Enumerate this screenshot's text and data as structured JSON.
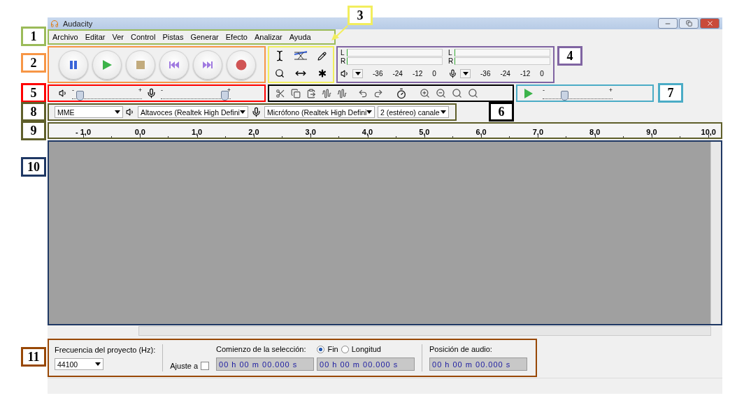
{
  "window": {
    "title": "Audacity"
  },
  "menu": [
    "Archivo",
    "Editar",
    "Ver",
    "Control",
    "Pistas",
    "Generar",
    "Efecto",
    "Analizar",
    "Ayuda"
  ],
  "meters": [
    {
      "channels": [
        "L",
        "R"
      ],
      "ticks": [
        "-36",
        "-24",
        "-12",
        "0"
      ]
    },
    {
      "channels": [
        "L",
        "R"
      ],
      "ticks": [
        "-36",
        "-24",
        "-12",
        "0"
      ]
    }
  ],
  "mixer": {
    "sliders": [
      {
        "min_mark": "-",
        "max_mark": "+",
        "level": 0.1
      },
      {
        "min_mark": "-",
        "max_mark": "+",
        "level": 0.9
      }
    ]
  },
  "play_at_speed": {
    "min_mark": "-",
    "max_mark": "+",
    "level": 0.3
  },
  "devices": {
    "host": "MME",
    "output": "Altavoces (Realtek High Defini",
    "input": "Micrófono (Realtek High Defini",
    "channels": "2 (estéreo) canale"
  },
  "ruler": {
    "ticks": [
      "- 1,0",
      "0,0",
      "1,0",
      "2,0",
      "3,0",
      "4,0",
      "5,0",
      "6,0",
      "7,0",
      "8,0",
      "9,0",
      "10,0"
    ]
  },
  "selection_toolbar": {
    "rate_label": "Frecuencia del proyecto (Hz):",
    "rate": "44100",
    "snap_label": "Ajuste a",
    "snap_checked": false,
    "start_label": "Comienzo de la selección:",
    "end_options": [
      {
        "label": "Fin",
        "selected": true
      },
      {
        "label": "Longitud",
        "selected": false
      }
    ],
    "start_time": "00 h 00 m 00.000 s",
    "end_time": "00 h 00 m 00.000 s",
    "position_label": "Posición de audio:",
    "position_time": "00 h 00 m 00.000 s"
  },
  "annotations": [
    {
      "number": "1",
      "color": "#9bbb59"
    },
    {
      "number": "2",
      "color": "#f79646"
    },
    {
      "number": "3",
      "color": "#f2ee5e"
    },
    {
      "number": "4",
      "color": "#8064a2"
    },
    {
      "number": "5",
      "color": "#ff0000"
    },
    {
      "number": "6",
      "color": "#000000"
    },
    {
      "number": "7",
      "color": "#4bacc6"
    },
    {
      "number": "8",
      "color": "#5f5f2a"
    },
    {
      "number": "9",
      "color": "#5f5f2a"
    },
    {
      "number": "10",
      "color": "#1f3864"
    },
    {
      "number": "11",
      "color": "#984806"
    }
  ]
}
